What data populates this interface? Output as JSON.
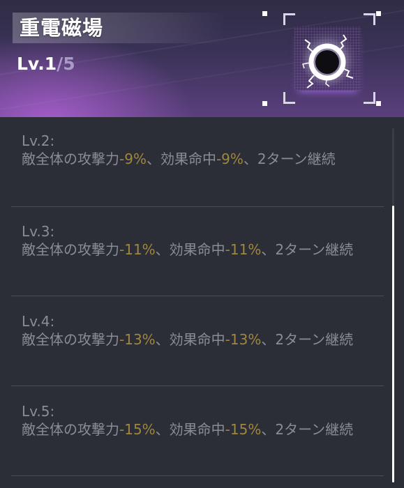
{
  "skill": {
    "name": "重電磁場",
    "level_prefix": "Lv.",
    "level_current": "1",
    "level_sep": "/",
    "level_max": "5"
  },
  "icon": {
    "name": "electromagnetic-orb-icon"
  },
  "colors": {
    "highlight_value": "#a0873e",
    "body_text": "#8a8d94",
    "header_purple": "#5a3f7c"
  },
  "levels": [
    {
      "label": "Lv.2:",
      "t1": "敵全体の攻撃力",
      "v1": "-9%",
      "t2": "、効果命中",
      "v2": "-9%",
      "t3": "、2ターン継続"
    },
    {
      "label": "Lv.3:",
      "t1": "敵全体の攻撃力",
      "v1": "-11%",
      "t2": "、効果命中",
      "v2": "-11%",
      "t3": "、2ターン継続"
    },
    {
      "label": "Lv.4:",
      "t1": "敵全体の攻撃力",
      "v1": "-13%",
      "t2": "、効果命中",
      "v2": "-13%",
      "t3": "、2ターン継続"
    },
    {
      "label": "Lv.5:",
      "t1": "敵全体の攻撃力",
      "v1": "-15%",
      "t2": "、効果命中",
      "v2": "-15%",
      "t3": "、2ターン継続"
    }
  ]
}
